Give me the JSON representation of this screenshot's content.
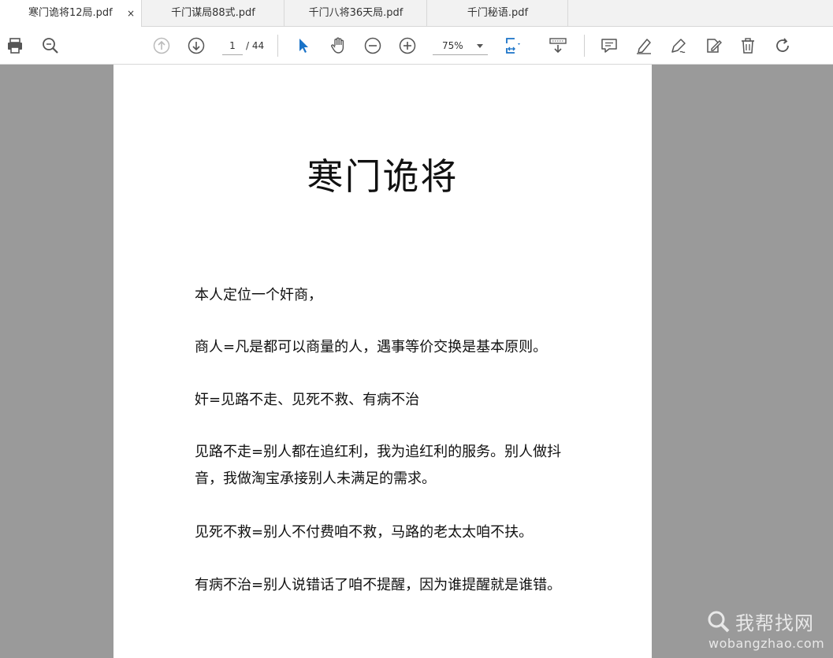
{
  "tabs": [
    {
      "label": "寒门诡将12局.pdf",
      "active": true,
      "close": "×"
    },
    {
      "label": "千门谋局88式.pdf",
      "active": false
    },
    {
      "label": "千门八将36天局.pdf",
      "active": false
    },
    {
      "label": "千门秘语.pdf",
      "active": false
    }
  ],
  "toolbar": {
    "page_current": "1",
    "page_total": "/ 44",
    "zoom": "75%",
    "accent": "#1a73c8"
  },
  "document": {
    "title": "寒门诡将",
    "paragraphs": [
      "本人定位一个奸商，",
      "商人=凡是都可以商量的人，遇事等价交换是基本原则。",
      "奸=见路不走、见死不救、有病不治",
      "见路不走=别人都在追红利，我为追红利的服务。别人做抖音，我做淘宝承接别人未满足的需求。",
      "见死不救=别人不付费咱不救，马路的老太太咱不扶。",
      "有病不治=别人说错话了咱不提醒，因为谁提醒就是谁错。"
    ]
  },
  "watermark": {
    "title": "我帮找网",
    "url": "wobangzhao.com"
  }
}
